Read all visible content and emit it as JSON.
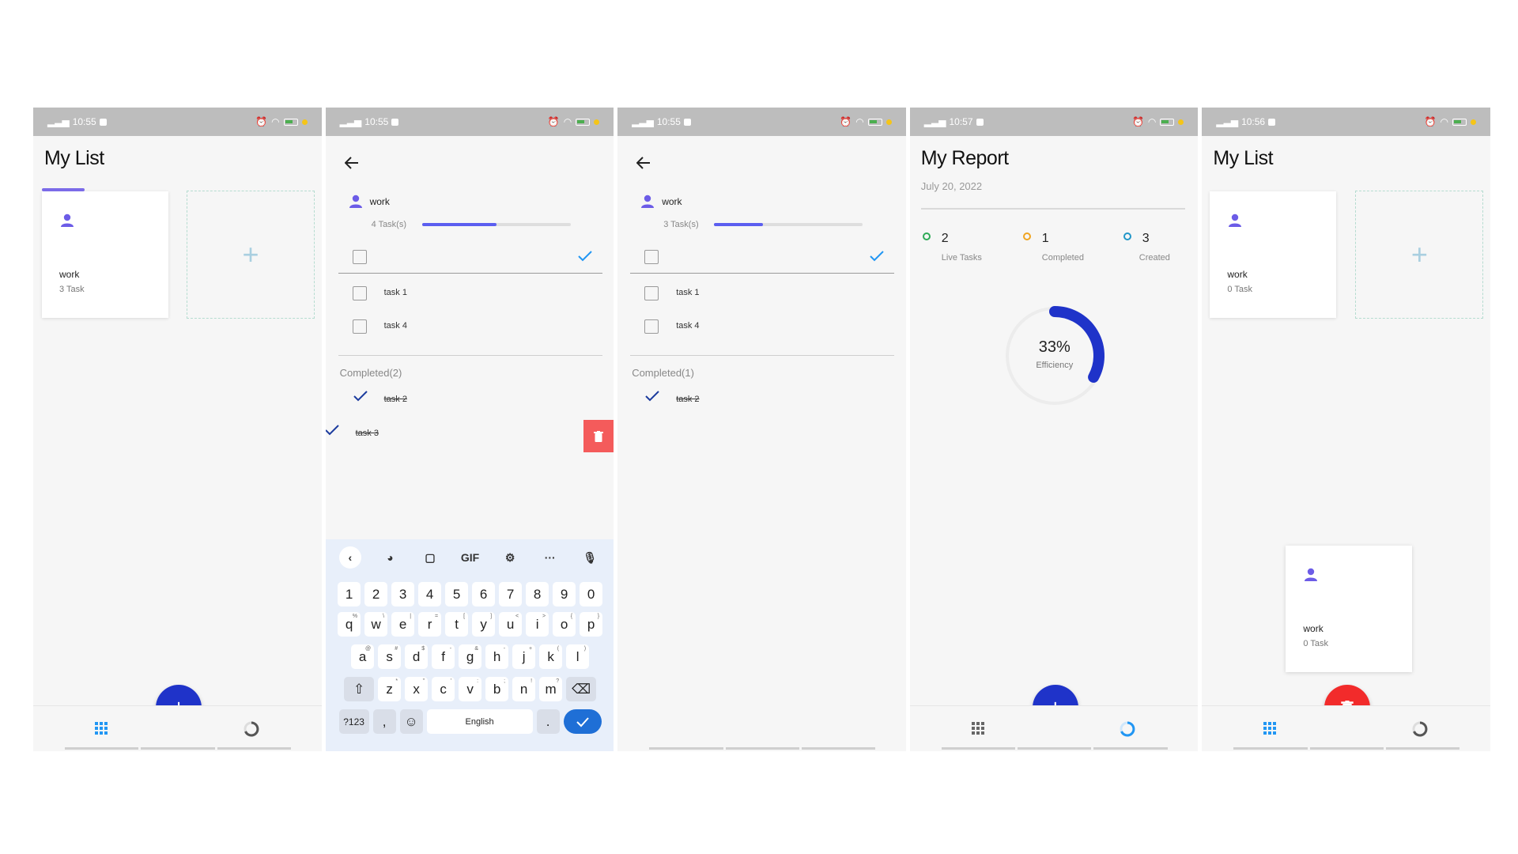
{
  "screens": [
    {
      "status": {
        "time": "10:55"
      },
      "title": "My List",
      "card": {
        "name": "work",
        "count": "3 Task"
      },
      "fab_icon": "plus-icon"
    },
    {
      "status": {
        "time": "10:55"
      },
      "detail": {
        "name": "work",
        "task_count": "4 Task(s)",
        "progress": 0.5
      },
      "tasks": [
        "task 1",
        "task 4"
      ],
      "completed_header": "Completed(2)",
      "completed": [
        "task 2",
        "task 3"
      ],
      "keyboard": {
        "numbers": [
          "1",
          "2",
          "3",
          "4",
          "5",
          "6",
          "7",
          "8",
          "9",
          "0"
        ],
        "row1": [
          {
            "k": "q",
            "s": "%"
          },
          {
            "k": "w",
            "s": "\\"
          },
          {
            "k": "e",
            "s": "|"
          },
          {
            "k": "r",
            "s": "="
          },
          {
            "k": "t",
            "s": "["
          },
          {
            "k": "y",
            "s": "]"
          },
          {
            "k": "u",
            "s": "<"
          },
          {
            "k": "i",
            "s": ">"
          },
          {
            "k": "o",
            "s": "{"
          },
          {
            "k": "p",
            "s": "}"
          }
        ],
        "row2": [
          {
            "k": "a",
            "s": "@"
          },
          {
            "k": "s",
            "s": "#"
          },
          {
            "k": "d",
            "s": "$"
          },
          {
            "k": "f",
            "s": "-"
          },
          {
            "k": "g",
            "s": "&"
          },
          {
            "k": "h",
            "s": "-"
          },
          {
            "k": "j",
            "s": "+"
          },
          {
            "k": "k",
            "s": "("
          },
          {
            "k": "l",
            "s": ")"
          }
        ],
        "row3": [
          {
            "k": "z",
            "s": "*"
          },
          {
            "k": "x",
            "s": "\""
          },
          {
            "k": "c",
            "s": "'"
          },
          {
            "k": "v",
            "s": ":"
          },
          {
            "k": "b",
            "s": ";"
          },
          {
            "k": "n",
            "s": "!"
          },
          {
            "k": "m",
            "s": "?"
          }
        ],
        "symbols_key": "?123",
        "comma_key": ",",
        "space_label": "English",
        "period_key": ".",
        "gif_label": "GIF",
        "more_label": "···"
      }
    },
    {
      "status": {
        "time": "10:55"
      },
      "detail": {
        "name": "work",
        "task_count": "3 Task(s)",
        "progress": 0.33
      },
      "tasks": [
        "task 1",
        "task 4"
      ],
      "completed_header": "Completed(1)",
      "completed": [
        "task 2"
      ]
    },
    {
      "status": {
        "time": "10:57"
      },
      "title": "My Report",
      "date": "July 20, 2022",
      "stats": [
        {
          "value": "2",
          "label": "Live Tasks",
          "color": "#2eaa57"
        },
        {
          "value": "1",
          "label": "Completed",
          "color": "#f0a420"
        },
        {
          "value": "3",
          "label": "Created",
          "color": "#2196c8"
        }
      ],
      "efficiency": {
        "percent": "33%",
        "label": "Efficiency",
        "fraction": 0.33
      }
    },
    {
      "status": {
        "time": "10:56"
      },
      "title": "My List",
      "card": {
        "name": "work",
        "count": "0 Task"
      },
      "drag_card": {
        "name": "work",
        "count": "0 Task"
      },
      "fab_icon": "trash-icon"
    }
  ],
  "colors": {
    "accent": "#1f33c9",
    "danger": "#f22b2b",
    "progress": "#5b5ef0",
    "person": "#6c5ce7",
    "nav_active": "#2196f3"
  }
}
